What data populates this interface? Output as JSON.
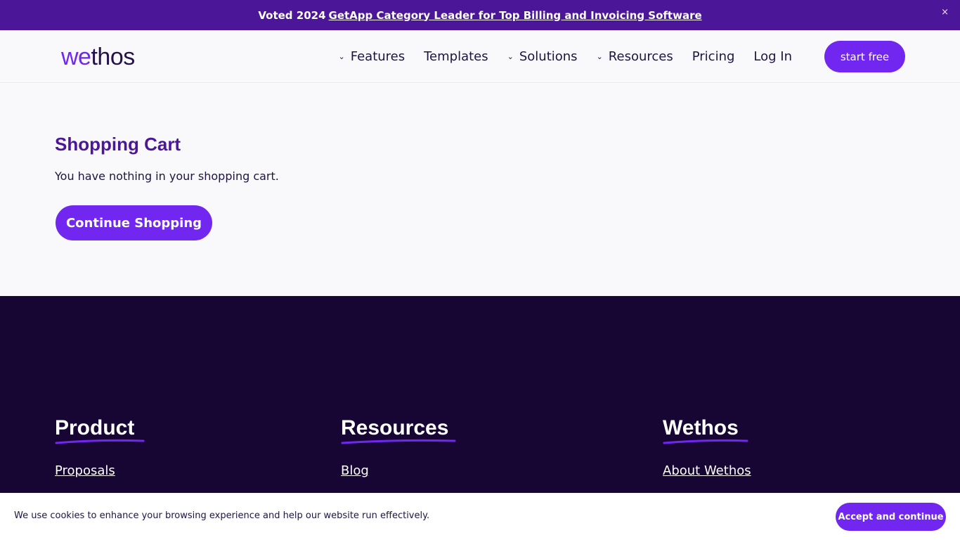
{
  "announcement": {
    "prefix": "Voted 2024",
    "link_text": "GetApp Category Leader for Top Billing and Invoicing Software",
    "close_glyph": "×"
  },
  "header": {
    "logo": {
      "part1": "we",
      "part2": "thos"
    },
    "nav": [
      {
        "label": "Features",
        "has_dropdown": true
      },
      {
        "label": "Templates",
        "has_dropdown": false
      },
      {
        "label": "Solutions",
        "has_dropdown": true
      },
      {
        "label": "Resources",
        "has_dropdown": true
      },
      {
        "label": "Pricing",
        "has_dropdown": false
      },
      {
        "label": "Log In",
        "has_dropdown": false
      }
    ],
    "cta_label": "start free"
  },
  "main": {
    "title": "Shopping Cart",
    "message": "You have nothing in your shopping cart.",
    "button_label": "Continue Shopping"
  },
  "footer": {
    "columns": [
      {
        "heading": "Product",
        "first_link": "Proposals"
      },
      {
        "heading": "Resources",
        "first_link": "Blog"
      },
      {
        "heading": "Wethos",
        "first_link": "About Wethos"
      }
    ]
  },
  "cookie": {
    "text": "We use cookies to enhance your browsing experience and help our website run effectively.",
    "button_label": "Accept and continue"
  },
  "colors": {
    "brand_purple": "#7127f0",
    "announce_bg": "#4b1697",
    "footer_bg": "#170634",
    "title_purple": "#4b1697"
  },
  "icons": {
    "chevron": "chevron-down-icon",
    "close": "close-icon"
  }
}
